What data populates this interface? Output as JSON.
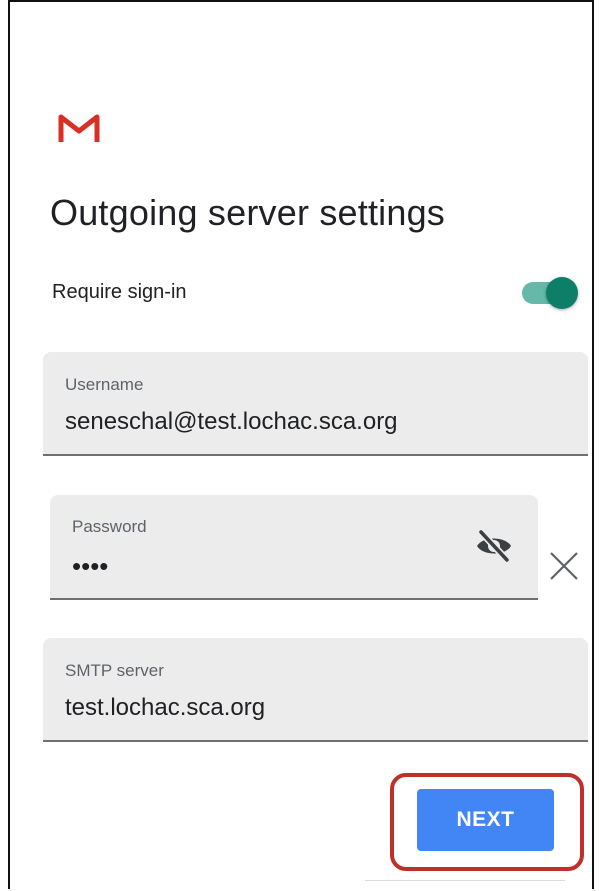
{
  "header": {
    "logo_icon": "gmail-logo-icon",
    "brand_color": "#d93025",
    "title": "Outgoing server settings"
  },
  "require_signin": {
    "label": "Require sign-in",
    "enabled": true,
    "track_color": "#66b8a9",
    "thumb_color": "#0d7f69"
  },
  "fields": {
    "username": {
      "label": "Username",
      "value": "seneschal@test.lochac.sca.org"
    },
    "password": {
      "label": "Password",
      "value": "••••",
      "visibility_icon": "eye-off-icon",
      "clear_icon": "close-icon"
    },
    "smtp_server": {
      "label": "SMTP server",
      "value": "test.lochac.sca.org"
    }
  },
  "actions": {
    "next_label": "NEXT",
    "next_color": "#4285f4",
    "highlight_color": "#c0302a"
  }
}
